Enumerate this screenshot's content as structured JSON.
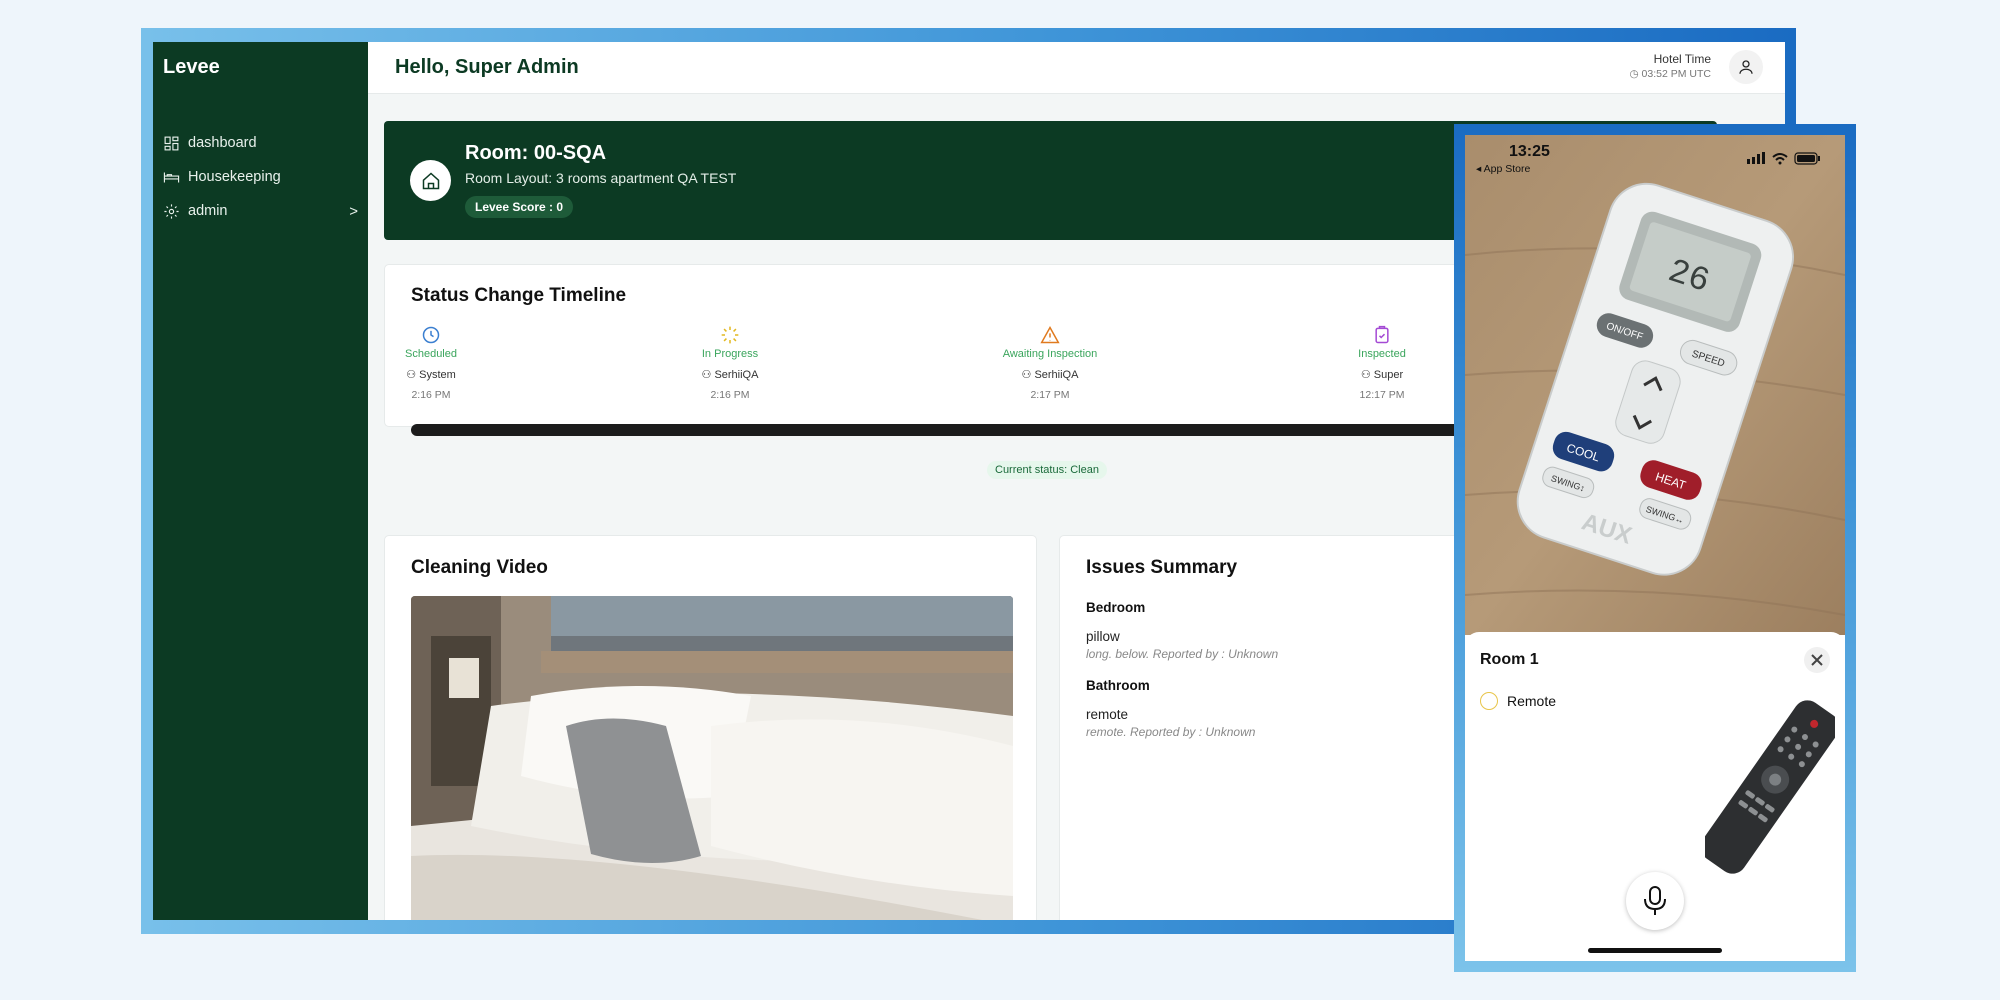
{
  "app": {
    "brand": "Levee"
  },
  "sidebar": {
    "items": [
      {
        "label": "dashboard",
        "icon": "grid-icon"
      },
      {
        "label": "Housekeeping",
        "icon": "bed-icon"
      },
      {
        "label": "admin",
        "icon": "gear-icon",
        "chevron": ">"
      }
    ]
  },
  "topbar": {
    "greeting": "Hello, Super Admin",
    "hotel_time_label": "Hotel Time",
    "hotel_time_value": "03:52 PM UTC"
  },
  "room": {
    "title": "Room: 00-SQA",
    "layout": "Room Layout: 3 rooms apartment QA TEST",
    "score": "Levee Score : 0"
  },
  "timeline": {
    "title": "Status Change Timeline",
    "steps": [
      {
        "status": "Scheduled",
        "user": "System",
        "time": "2:16 PM",
        "color": "#3aa55c",
        "icon": "clock-icon"
      },
      {
        "status": "In Progress",
        "user": "SerhiiQA",
        "time": "2:16 PM",
        "color": "#e2b820",
        "icon": "loader-icon"
      },
      {
        "status": "Awaiting Inspection",
        "user": "SerhiiQA",
        "time": "2:17 PM",
        "color": "#e07a1f",
        "icon": "alert-icon"
      },
      {
        "status": "Inspected",
        "user": "Super",
        "time": "12:17 PM",
        "color": "#a44ad4",
        "icon": "clipboard-check-icon"
      }
    ],
    "current_status": "Current status: Clean"
  },
  "video": {
    "title": "Cleaning Video"
  },
  "issues": {
    "title": "Issues Summary",
    "rooms": [
      {
        "name": "Bedroom",
        "item": "pillow",
        "description": "long. below. Reported by : Unknown"
      },
      {
        "name": "Bathroom",
        "item": "remote",
        "description": "remote.  Reported by : Unknown"
      }
    ]
  },
  "phone": {
    "time": "13:25",
    "back_label": "◂ App Store",
    "sheet_title": "Room 1",
    "checklist_item": "Remote",
    "remote_brand": "AUX",
    "remote_display": "26",
    "remote_buttons": [
      "ON/OFF",
      "SPEED",
      "COOL",
      "HEAT",
      "SWING↕",
      "SWING↔"
    ]
  }
}
